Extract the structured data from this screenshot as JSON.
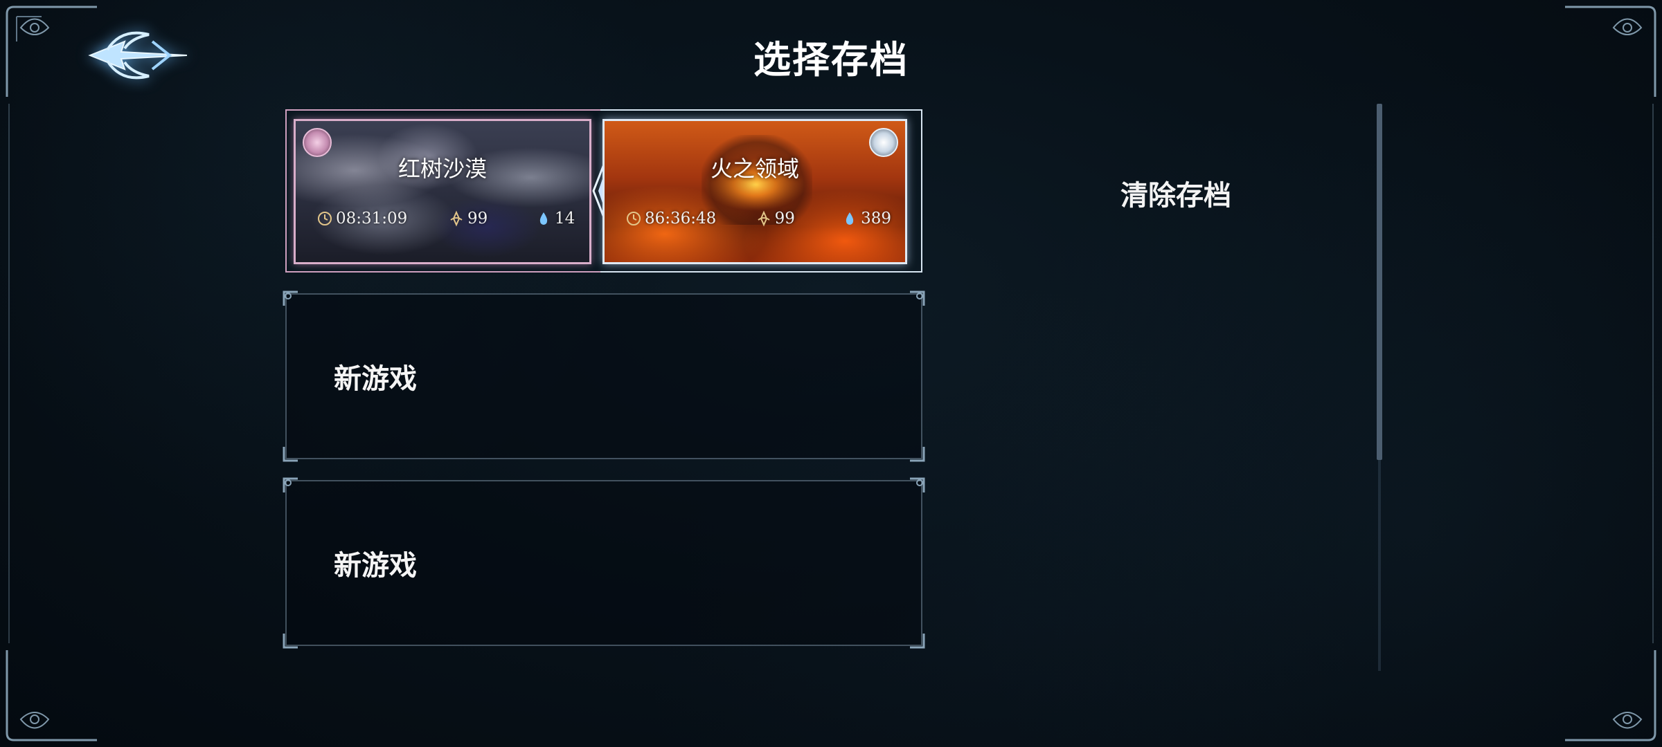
{
  "header": {
    "title": "选择存档",
    "back_icon": "winged-arrow-back-icon"
  },
  "slots": [
    {
      "type": "filled",
      "left": {
        "zone": "红树沙漠",
        "time": "08:31:09",
        "level": "99",
        "gems": "14",
        "badge_color": "#e7bcd7"
      },
      "right": {
        "zone": "火之领域",
        "time": "86:36:48",
        "level": "99",
        "gems": "389",
        "badge_color": "#e8f0f8"
      }
    },
    {
      "type": "new",
      "label": "新游戏"
    },
    {
      "type": "new",
      "label": "新游戏"
    }
  ],
  "actions": {
    "clear_save": "清除存档"
  },
  "colors": {
    "accent_pink": "#d9aeca",
    "accent_ice": "#dfe9f4",
    "background": "#050b12",
    "back_glow": "#6ebeff"
  }
}
